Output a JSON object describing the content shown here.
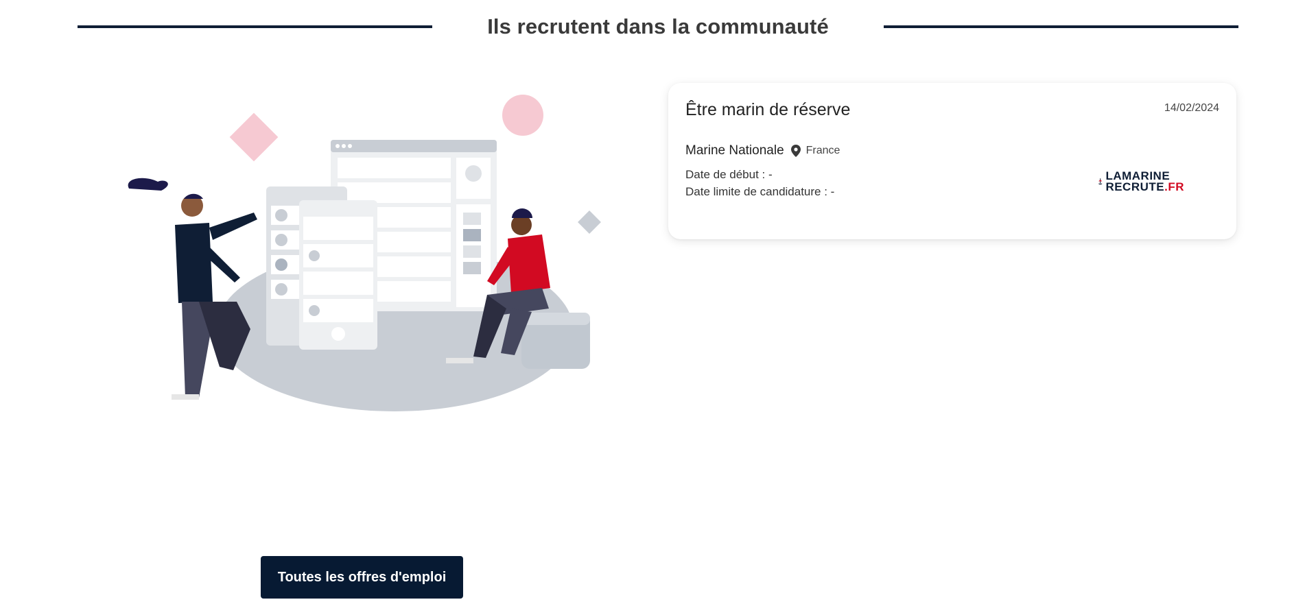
{
  "section": {
    "title": "Ils recrutent dans la communauté"
  },
  "job": {
    "title": "Être marin de réserve",
    "date": "14/02/2024",
    "company": "Marine Nationale",
    "location": "France",
    "start_date_line": "Date de début : -",
    "deadline_line": "Date limite de candidature : -",
    "logo": {
      "line1": "LAMARINE",
      "line2_main": "RECRUTE",
      "line2_accent": ".FR"
    }
  },
  "cta": {
    "label": "Toutes les offres d'emploi"
  },
  "colors": {
    "navy": "#0f1e35",
    "button": "#071a33",
    "accent_red": "#d20a22",
    "pink_shape": "#f6c9d2",
    "gray_shape": "#c8cdd4"
  },
  "icons": {
    "location": "map-pin-icon"
  }
}
